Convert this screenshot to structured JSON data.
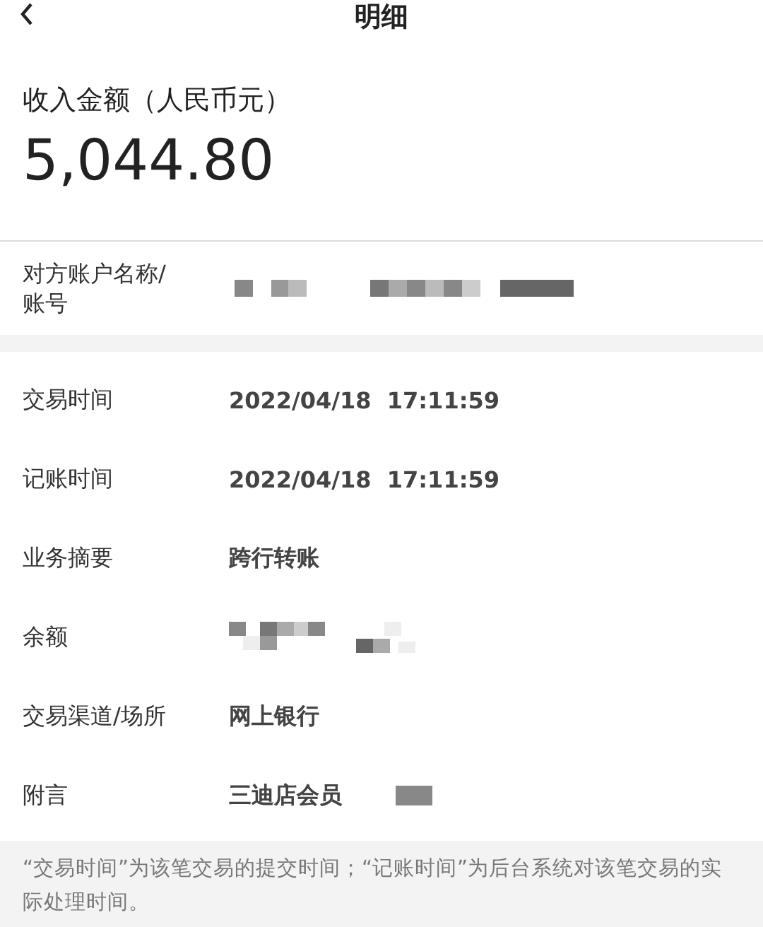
{
  "header": {
    "title": "明细"
  },
  "amount": {
    "label": "收入金额（人民币元）",
    "value": "5,044.80"
  },
  "counterparty": {
    "label": "对方账户名称/账号",
    "kind": "masked"
  },
  "rows": [
    {
      "label": "交易时间",
      "kind": "text",
      "value": "2022/04/18  17:11:59"
    },
    {
      "label": "记账时间",
      "kind": "text",
      "value": "2022/04/18  17:11:59"
    },
    {
      "label": "业务摘要",
      "kind": "text",
      "value": "跨行转账"
    },
    {
      "label": "余额",
      "kind": "masked"
    },
    {
      "label": "交易渠道/场所",
      "kind": "text",
      "value": "网上银行"
    },
    {
      "label": "附言",
      "kind": "text_masked",
      "value": "三迪店会员"
    }
  ],
  "note": "“交易时间”为该笔交易的提交时间；“记账时间”为后台系统对该笔交易的实际处理时间。"
}
